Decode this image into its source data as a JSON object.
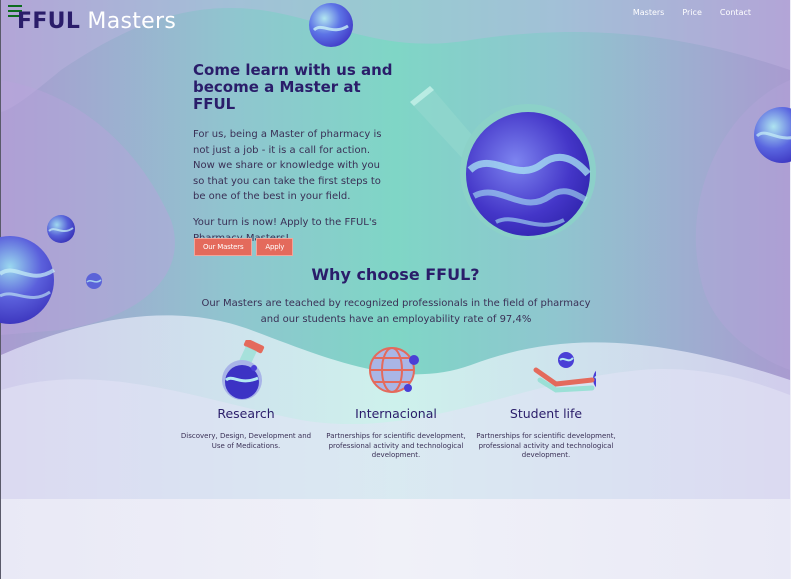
{
  "nav": {
    "logo_bold": "FFUL",
    "logo_light": " Masters",
    "links": [
      "Masters",
      "Price",
      "Contact"
    ]
  },
  "hero": {
    "title": "Come learn with us and become a Master at FFUL",
    "paragraph1": "For us, being a Master of pharmacy is not just a job - it is a call for action. Now we share or knowledge with you so that you can take the first steps to be one of the best in your field.",
    "paragraph2": "Your turn is now! Apply to the FFUL's Pharmacy Masters!",
    "buttons": [
      "Our Masters",
      "Apply"
    ]
  },
  "why": {
    "title": "Why choose FFUL?",
    "text": "Our Masters are teached by recognized professionals in the field of pharmacy and our students have an employability rate of 97,4%"
  },
  "features": [
    {
      "title": "Research",
      "text": "Discovery, Design, Development and Use of Medications.",
      "icon": "flask-icon"
    },
    {
      "title": "Internacional",
      "text": "Partnerships for scientific development, professional activity and technological development.",
      "icon": "globe-icon"
    },
    {
      "title": "Student life",
      "text": "Partnerships for scientific development, professional activity and technological development.",
      "icon": "hand-with-spheres-icon"
    }
  ],
  "colors": {
    "brand": "#2a1d6a",
    "button": "#e46a5c",
    "teal": "#7fd6c6",
    "purple": "#a99bd0"
  }
}
